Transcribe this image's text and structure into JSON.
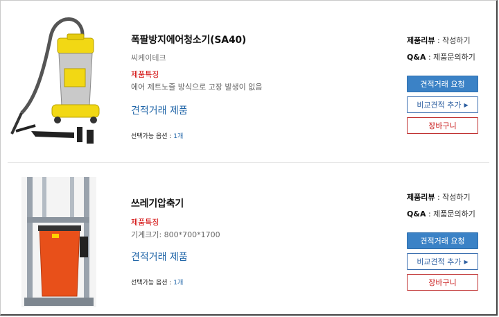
{
  "products": [
    {
      "title": "폭팔방지에어청소기(SA40)",
      "maker": "씨케이테크",
      "feature_label": "제품특징",
      "feature_text": "에어 제트노즐 방식으로 고장 발생이 없음",
      "trade_link": "견적거래 제품",
      "options_label": "선택가능 옵션 : ",
      "options_count": "1개",
      "review_key": "제품리뷰",
      "review_value": " : 작성하기",
      "qa_key": "Q&A",
      "qa_value": " : 제품문의하기",
      "btn_quote": "견적거래 요청",
      "btn_compare": "비교견적 추가",
      "btn_cart": "장바구니",
      "image_icon": "vacuum-cleaner-image"
    },
    {
      "title": "쓰레기압축기",
      "maker": "",
      "feature_label": "제품특징",
      "feature_text": "기계크기: 800*700*1700",
      "trade_link": "견적거래 제품",
      "options_label": "선택가능 옵션 : ",
      "options_count": "1개",
      "review_key": "제품리뷰",
      "review_value": " : 작성하기",
      "qa_key": "Q&A",
      "qa_value": " : 제품문의하기",
      "btn_quote": "견적거래 요청",
      "btn_compare": "비교견적 추가",
      "btn_cart": "장바구니",
      "image_icon": "trash-compactor-image"
    }
  ],
  "colors": {
    "accent_blue": "#3b82c6",
    "link_blue": "#2166a8",
    "feature_red": "#d10000",
    "vacuum_yellow": "#f2d814",
    "compactor_orange": "#e8501a"
  }
}
